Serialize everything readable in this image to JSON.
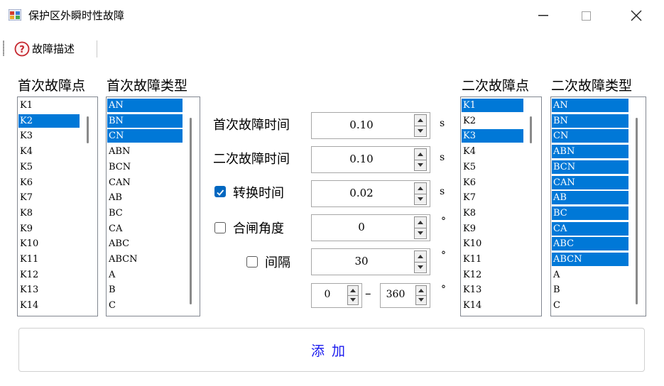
{
  "window": {
    "title": "保护区外瞬时性故障",
    "minimize_label": "—",
    "maximize_label": "□",
    "close_label": "✕"
  },
  "toolbar": {
    "help_label": "故障描述",
    "help_icon": "question-circle-icon"
  },
  "headers": {
    "first_point": "首次故障点",
    "first_type": "首次故障类型",
    "second_point": "二次故障点",
    "second_type": "二次故障类型"
  },
  "lists": {
    "first_point": [
      {
        "label": "K1",
        "selected": false
      },
      {
        "label": "K2",
        "selected": true
      },
      {
        "label": "K3",
        "selected": false
      },
      {
        "label": "K4",
        "selected": false
      },
      {
        "label": "K5",
        "selected": false
      },
      {
        "label": "K6",
        "selected": false
      },
      {
        "label": "K7",
        "selected": false
      },
      {
        "label": "K8",
        "selected": false
      },
      {
        "label": "K9",
        "selected": false
      },
      {
        "label": "K10",
        "selected": false
      },
      {
        "label": "K11",
        "selected": false
      },
      {
        "label": "K12",
        "selected": false
      },
      {
        "label": "K13",
        "selected": false
      },
      {
        "label": "K14",
        "selected": false
      }
    ],
    "first_type": [
      {
        "label": "AN",
        "selected": true
      },
      {
        "label": "BN",
        "selected": true
      },
      {
        "label": "CN",
        "selected": true
      },
      {
        "label": "ABN",
        "selected": false
      },
      {
        "label": "BCN",
        "selected": false
      },
      {
        "label": "CAN",
        "selected": false
      },
      {
        "label": "AB",
        "selected": false
      },
      {
        "label": "BC",
        "selected": false
      },
      {
        "label": "CA",
        "selected": false
      },
      {
        "label": "ABC",
        "selected": false
      },
      {
        "label": "ABCN",
        "selected": false
      },
      {
        "label": "A",
        "selected": false
      },
      {
        "label": "B",
        "selected": false
      },
      {
        "label": "C",
        "selected": false
      }
    ],
    "second_point": [
      {
        "label": "K1",
        "selected": true
      },
      {
        "label": "K2",
        "selected": false
      },
      {
        "label": "K3",
        "selected": true
      },
      {
        "label": "K4",
        "selected": false
      },
      {
        "label": "K5",
        "selected": false
      },
      {
        "label": "K6",
        "selected": false
      },
      {
        "label": "K7",
        "selected": false
      },
      {
        "label": "K8",
        "selected": false
      },
      {
        "label": "K9",
        "selected": false
      },
      {
        "label": "K10",
        "selected": false
      },
      {
        "label": "K11",
        "selected": false
      },
      {
        "label": "K12",
        "selected": false
      },
      {
        "label": "K13",
        "selected": false
      },
      {
        "label": "K14",
        "selected": false
      }
    ],
    "second_type": [
      {
        "label": "AN",
        "selected": true
      },
      {
        "label": "BN",
        "selected": true
      },
      {
        "label": "CN",
        "selected": true
      },
      {
        "label": "ABN",
        "selected": true
      },
      {
        "label": "BCN",
        "selected": true
      },
      {
        "label": "CAN",
        "selected": true
      },
      {
        "label": "AB",
        "selected": true
      },
      {
        "label": "BC",
        "selected": true
      },
      {
        "label": "CA",
        "selected": true
      },
      {
        "label": "ABC",
        "selected": true
      },
      {
        "label": "ABCN",
        "selected": true
      },
      {
        "label": "A",
        "selected": false
      },
      {
        "label": "B",
        "selected": false
      },
      {
        "label": "C",
        "selected": false
      }
    ]
  },
  "params": {
    "first_time": {
      "label": "首次故障时间",
      "value": "0.10",
      "unit": "s"
    },
    "second_time": {
      "label": "二次故障时间",
      "value": "0.10",
      "unit": "s"
    },
    "switch_time": {
      "label": "转换时间",
      "value": "0.02",
      "unit": "s",
      "checked": true
    },
    "close_angle": {
      "label": "合闸角度",
      "value": "0",
      "unit": "°",
      "checked": false
    },
    "interval": {
      "label": "间隔",
      "value": "30",
      "unit": "°",
      "checked": false
    },
    "range": {
      "from": "0",
      "separator": "–",
      "to": "360",
      "unit": "°"
    }
  },
  "add_button": {
    "label": "添加"
  },
  "colors": {
    "selection": "#0078d7",
    "checkbox_on": "#0067c0",
    "add_text": "#1a1aee"
  }
}
